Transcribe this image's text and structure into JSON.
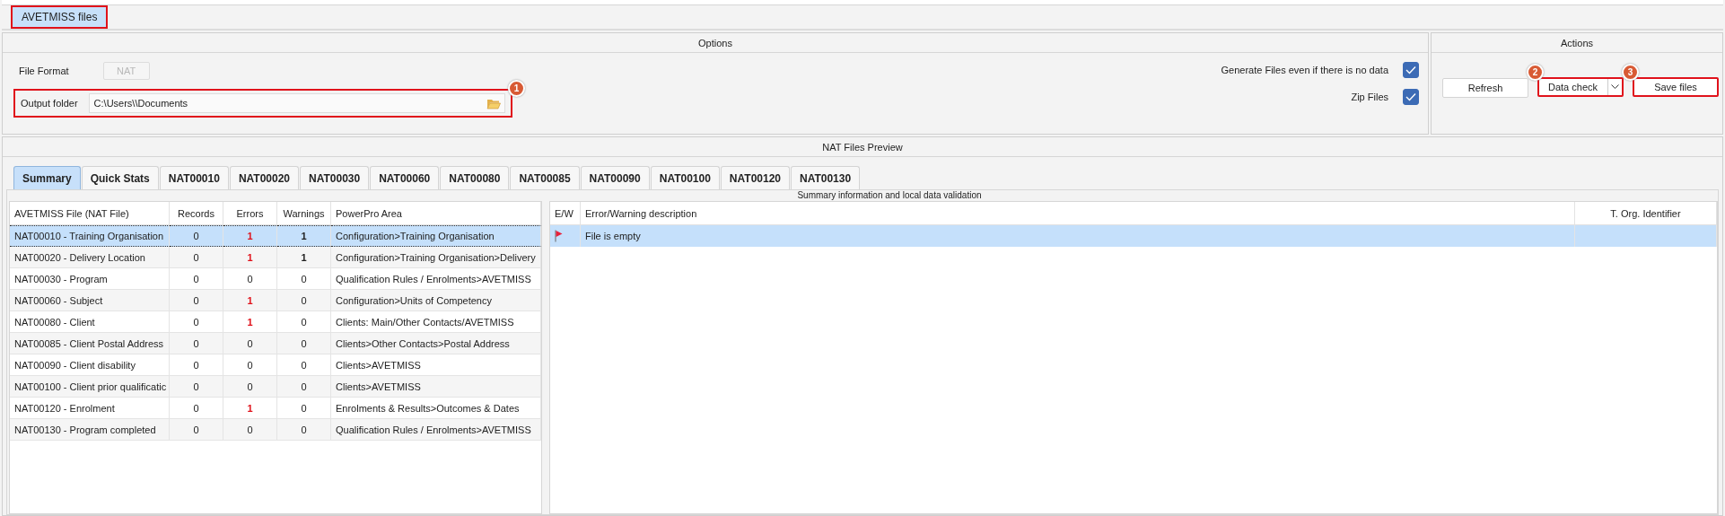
{
  "top_tab": {
    "label": "AVETMISS files",
    "selected": true,
    "highlighted": true
  },
  "options": {
    "title": "Options",
    "file_format": {
      "label": "File Format",
      "value": "NAT",
      "disabled": true
    },
    "output_folder": {
      "label": "Output folder",
      "value": "C:\\Users\\\\Documents",
      "highlighted": true,
      "badge": "1"
    },
    "checkboxes": [
      {
        "label": "Generate Files even if there is no data",
        "checked": true
      },
      {
        "label": "Zip Files",
        "checked": true
      }
    ]
  },
  "actions": {
    "title": "Actions",
    "buttons": [
      {
        "label": "Refresh",
        "kind": "plain",
        "highlighted": false
      },
      {
        "label": "Data check",
        "kind": "split",
        "highlighted": true,
        "badge": "2"
      },
      {
        "label": "Save files",
        "kind": "plain",
        "highlighted": true,
        "badge": "3"
      }
    ]
  },
  "preview": {
    "title": "NAT Files Preview",
    "tabs": [
      {
        "label": "Summary",
        "selected": true
      },
      {
        "label": "Quick Stats",
        "selected": false
      },
      {
        "label": "NAT00010",
        "selected": false
      },
      {
        "label": "NAT00020",
        "selected": false
      },
      {
        "label": "NAT00030",
        "selected": false
      },
      {
        "label": "NAT00060",
        "selected": false
      },
      {
        "label": "NAT00080",
        "selected": false
      },
      {
        "label": "NAT00085",
        "selected": false
      },
      {
        "label": "NAT00090",
        "selected": false
      },
      {
        "label": "NAT00100",
        "selected": false
      },
      {
        "label": "NAT00120",
        "selected": false
      },
      {
        "label": "NAT00130",
        "selected": false
      }
    ],
    "caption": "Summary information and local data validation",
    "files_table": {
      "columns": [
        "AVETMISS File (NAT File)",
        "Records",
        "Errors",
        "Warnings",
        "PowerPro Area"
      ],
      "rows": [
        {
          "file": "NAT00010 - Training Organisation",
          "records": "0",
          "errors": "1",
          "errors_flagged": true,
          "warnings": "1",
          "warnings_flagged": true,
          "area": "Configuration>Training Organisation",
          "selected": true
        },
        {
          "file": "NAT00020 - Delivery Location",
          "records": "0",
          "errors": "1",
          "errors_flagged": true,
          "warnings": "1",
          "warnings_flagged": true,
          "area": "Configuration>Training Organisation>Delivery",
          "selected": false
        },
        {
          "file": "NAT00030 - Program",
          "records": "0",
          "errors": "0",
          "errors_flagged": false,
          "warnings": "0",
          "warnings_flagged": false,
          "area": "Qualification Rules / Enrolments>AVETMISS",
          "selected": false
        },
        {
          "file": "NAT00060 - Subject",
          "records": "0",
          "errors": "1",
          "errors_flagged": true,
          "warnings": "0",
          "warnings_flagged": false,
          "area": "Configuration>Units of Competency",
          "selected": false
        },
        {
          "file": "NAT00080 - Client",
          "records": "0",
          "errors": "1",
          "errors_flagged": true,
          "warnings": "0",
          "warnings_flagged": false,
          "area": "Clients: Main/Other Contacts/AVETMISS",
          "selected": false
        },
        {
          "file": "NAT00085 - Client Postal Address",
          "records": "0",
          "errors": "0",
          "errors_flagged": false,
          "warnings": "0",
          "warnings_flagged": false,
          "area": "Clients>Other Contacts>Postal Address",
          "selected": false
        },
        {
          "file": "NAT00090 - Client disability",
          "records": "0",
          "errors": "0",
          "errors_flagged": false,
          "warnings": "0",
          "warnings_flagged": false,
          "area": "Clients>AVETMISS",
          "selected": false
        },
        {
          "file": "NAT00100 - Client prior qualificatic",
          "records": "0",
          "errors": "0",
          "errors_flagged": false,
          "warnings": "0",
          "warnings_flagged": false,
          "area": "Clients>AVETMISS",
          "selected": false
        },
        {
          "file": "NAT00120 - Enrolment",
          "records": "0",
          "errors": "1",
          "errors_flagged": true,
          "warnings": "0",
          "warnings_flagged": false,
          "area": "Enrolments & Results>Outcomes & Dates",
          "selected": false
        },
        {
          "file": "NAT00130 - Program completed",
          "records": "0",
          "errors": "0",
          "errors_flagged": false,
          "warnings": "0",
          "warnings_flagged": false,
          "area": "Qualification Rules / Enrolments>AVETMISS",
          "selected": false
        }
      ]
    },
    "issues_table": {
      "columns": [
        "E/W",
        "Error/Warning description",
        "T. Org. Identifier"
      ],
      "rows": [
        {
          "kind": "error",
          "description": "File is empty",
          "selected": true
        }
      ]
    }
  }
}
